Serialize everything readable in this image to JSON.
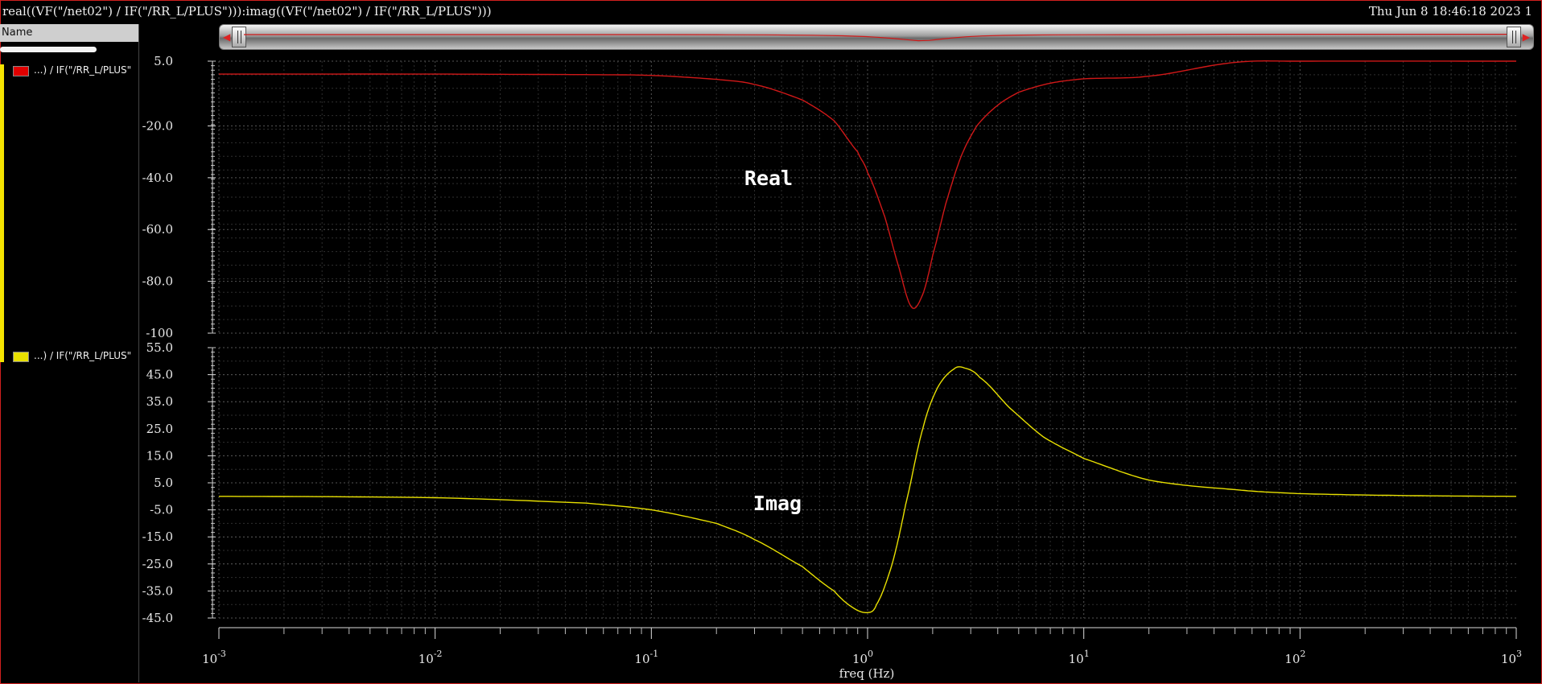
{
  "window": {
    "title_expression": "real((VF(\"/net02\") / IF(\"/RR_L/PLUS\"))):imag((VF(\"/net02\") / IF(\"/RR_L/PLUS\")))",
    "timestamp": "Thu Jun 8 18:46:18 2023  1"
  },
  "trace_panel": {
    "header": "Name",
    "items": [
      {
        "label": "...) / IF(\"/RR_L/PLUS\"",
        "color": "#e00000"
      },
      {
        "label": "...) / IF(\"/RR_L/PLUS\"",
        "color": "#e8e000"
      }
    ]
  },
  "chart_data": [
    {
      "type": "line",
      "x_scale": "log",
      "xlabel": "freq (Hz)",
      "xlim": [
        0.001,
        1000
      ],
      "ylim": [
        -100,
        5
      ],
      "yticks": [
        5,
        -20,
        -40,
        -60,
        -80,
        -100
      ],
      "ytick_labels": [
        "5.0",
        "-20.0",
        "-40.0",
        "-60.0",
        "-80.0",
        "-100"
      ],
      "annotation": "Real",
      "grid": true,
      "series": [
        {
          "color": "#d01818",
          "x": [
            0.001,
            0.01,
            0.05,
            0.1,
            0.2,
            0.3,
            0.5,
            0.7,
            0.9,
            1.0,
            1.2,
            1.4,
            1.6,
            1.8,
            2.0,
            2.3,
            2.7,
            3.2,
            4.0,
            5.0,
            7.0,
            10,
            20,
            50,
            100,
            1000
          ],
          "y": [
            0,
            0,
            -0.2,
            -0.5,
            -2,
            -4,
            -10,
            -18,
            -30,
            -38,
            -55,
            -75,
            -90,
            -85,
            -70,
            -50,
            -32,
            -20,
            -12,
            -7,
            -3.5,
            -1.8,
            -0.8,
            4.5,
            5,
            5
          ]
        }
      ]
    },
    {
      "type": "line",
      "x_scale": "log",
      "xlabel": "freq (Hz)",
      "xlim": [
        0.001,
        1000
      ],
      "xticks": [
        0.001,
        0.01,
        0.1,
        1,
        10,
        100,
        1000
      ],
      "xtick_labels": [
        [
          "10",
          "-3"
        ],
        [
          "10",
          "-2"
        ],
        [
          "10",
          "-1"
        ],
        [
          "10",
          "0"
        ],
        [
          "10",
          "1"
        ],
        [
          "10",
          "2"
        ],
        [
          "10",
          "3"
        ]
      ],
      "ylim": [
        -45,
        55
      ],
      "yticks": [
        55,
        45,
        35,
        25,
        15,
        5,
        -5,
        -15,
        -25,
        -35,
        -45
      ],
      "ytick_labels": [
        "55.0",
        "45.0",
        "35.0",
        "25.0",
        "15.0",
        "5.0",
        "-5.0",
        "-15.0",
        "-25.0",
        "-35.0",
        "-45.0"
      ],
      "annotation": "Imag",
      "grid": true,
      "series": [
        {
          "color": "#e8e000",
          "x": [
            0.001,
            0.01,
            0.05,
            0.1,
            0.2,
            0.3,
            0.5,
            0.7,
            0.85,
            1.0,
            1.1,
            1.3,
            1.5,
            1.8,
            2.1,
            2.5,
            2.8,
            3.3,
            4.5,
            6.5,
            10,
            20,
            50,
            100,
            300,
            1000
          ],
          "y": [
            0,
            -0.5,
            -2.5,
            -5,
            -10,
            -16,
            -26,
            -35,
            -41,
            -43,
            -40,
            -25,
            -3,
            25,
            40,
            47,
            47.5,
            44,
            33,
            22,
            14,
            6,
            2.5,
            1,
            0.3,
            0
          ]
        }
      ]
    }
  ]
}
